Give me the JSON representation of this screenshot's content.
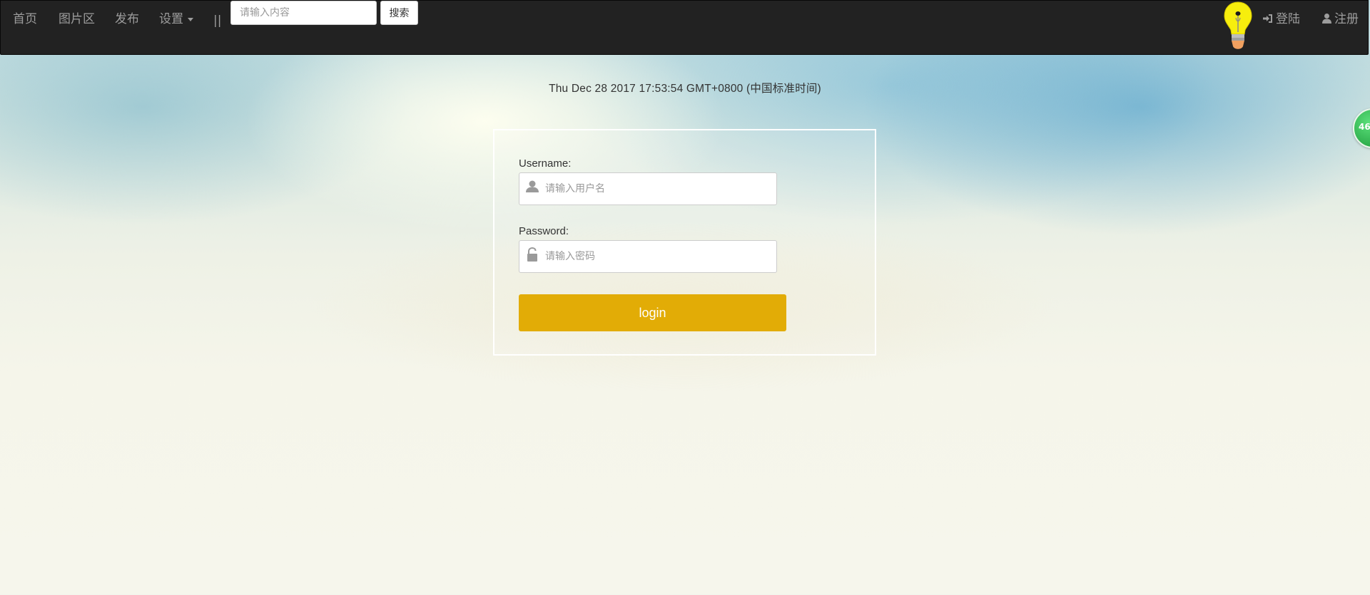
{
  "nav": {
    "home": "首页",
    "gallery": "图片区",
    "publish": "发布",
    "settings": "设置",
    "separator": "||",
    "search_placeholder": "请输入内容",
    "search_button": "搜索",
    "login": "登陆",
    "register": "注册"
  },
  "date_display": "Thu Dec 28 2017 17:53:54 GMT+0800 (中国标准时间)",
  "login_form": {
    "username_label": "Username:",
    "username_placeholder": "请输入用户名",
    "password_label": "Password:",
    "password_placeholder": "请输入密码",
    "submit_label": "login"
  },
  "side_widget": {
    "count": "46"
  },
  "colors": {
    "navbar_bg": "#222222",
    "nav_text": "#9d9d9d",
    "login_button": "#e2ac06",
    "widget_green": "#2fae4d"
  },
  "icons": {
    "username": "user-icon",
    "password": "lock-icon",
    "login": "sign-in-icon",
    "register": "user-icon",
    "logo": "lightbulb-icon"
  }
}
